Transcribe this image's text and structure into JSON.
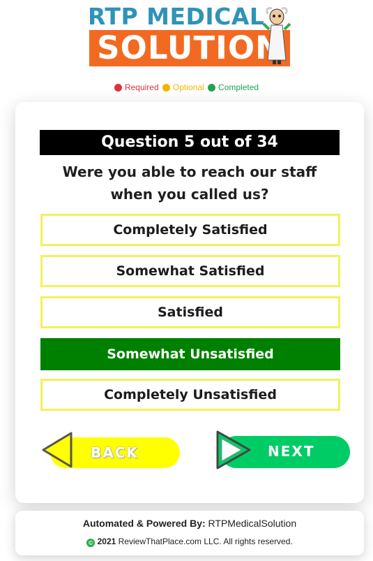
{
  "logo": {
    "line1": "RTP MEDICAL",
    "line2": "SOLUTION",
    "mascot_icon": "doctor-mascot-icon"
  },
  "legend": [
    {
      "label": "Required",
      "color": "#d9343a"
    },
    {
      "label": "Optional",
      "color": "#f5b400"
    },
    {
      "label": "Completed",
      "color": "#22a34a"
    }
  ],
  "question": {
    "header": "Question 5 out of 34",
    "text_line1": "Were you able to reach our staff",
    "text_line2": "when you called us?"
  },
  "options": [
    {
      "label": "Completely Satisfied",
      "selected": false
    },
    {
      "label": "Somewhat Satisfied",
      "selected": false
    },
    {
      "label": "Satisfied",
      "selected": false
    },
    {
      "label": "Somewhat Unsatisfied",
      "selected": true
    },
    {
      "label": "Completely Unsatisfied",
      "selected": false
    }
  ],
  "nav": {
    "back_label": "BACK",
    "next_label": "NEXT"
  },
  "footer": {
    "powered_prefix": "Automated & Powered By:",
    "powered_name": "RTPMedicalSolution",
    "copyright_year": "2021",
    "copyright_text": "ReviewThatPlace.com LLC. All rights reserved."
  },
  "colors": {
    "accent_blue": "#2f93b8",
    "brand_orange": "#f26a22",
    "selected_green": "#008000",
    "back_yellow": "#ffff00",
    "next_green": "#00cc66",
    "option_border": "#f2f25a"
  }
}
